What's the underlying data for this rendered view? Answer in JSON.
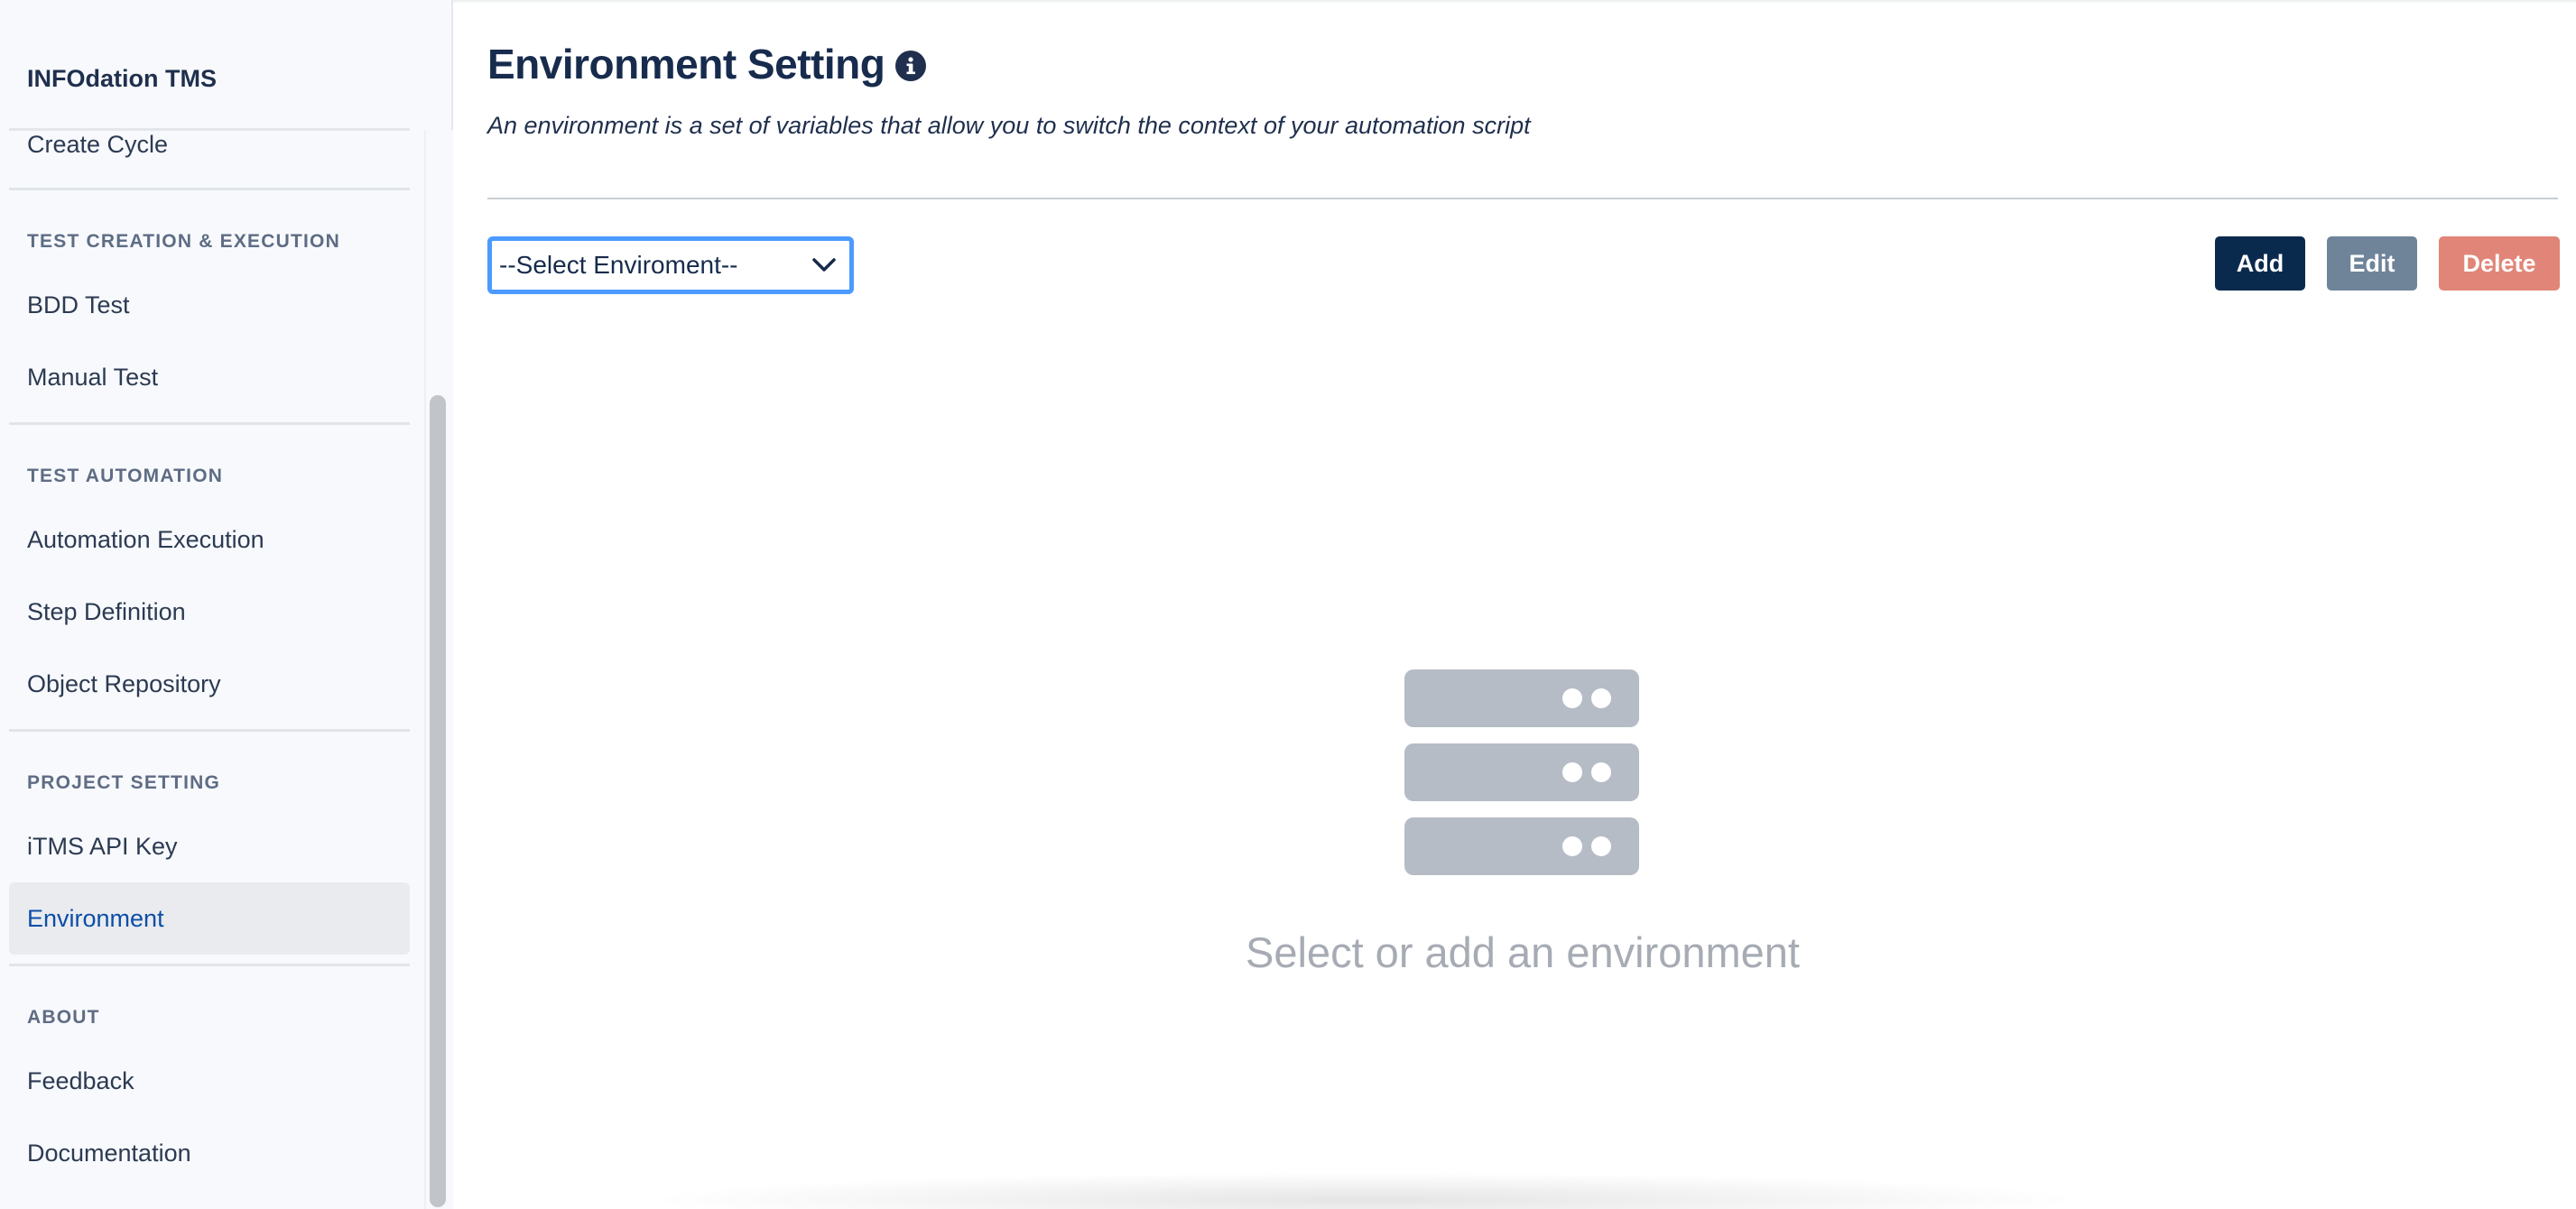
{
  "sidebar": {
    "brand": "INFOdation TMS",
    "top_item": "Create Cycle",
    "sections": [
      {
        "title": "TEST CREATION & EXECUTION",
        "items": [
          "BDD Test",
          "Manual Test"
        ]
      },
      {
        "title": "TEST AUTOMATION",
        "items": [
          "Automation Execution",
          "Step Definition",
          "Object Repository"
        ]
      },
      {
        "title": "PROJECT SETTING",
        "items": [
          "iTMS API Key",
          "Environment"
        ]
      },
      {
        "title": "ABOUT",
        "items": [
          "Feedback",
          "Documentation"
        ]
      }
    ],
    "active_item": "Environment"
  },
  "main": {
    "title": "Environment Setting",
    "subtitle": "An environment is a set of variables that allow you to switch the context of your automation script",
    "select": {
      "value": "--Select Enviroment--"
    },
    "buttons": {
      "add": "Add",
      "edit": "Edit",
      "delete": "Delete"
    },
    "empty_state": {
      "text": "Select or add an environment",
      "icon": "server-stack-icon"
    }
  },
  "colors": {
    "primary": "#0a2a4d",
    "edit": "#6f8499",
    "delete": "#e08577",
    "focus": "#4c9aff",
    "active_link": "#0d4ea6",
    "empty_icon": "#b6bcc6"
  }
}
